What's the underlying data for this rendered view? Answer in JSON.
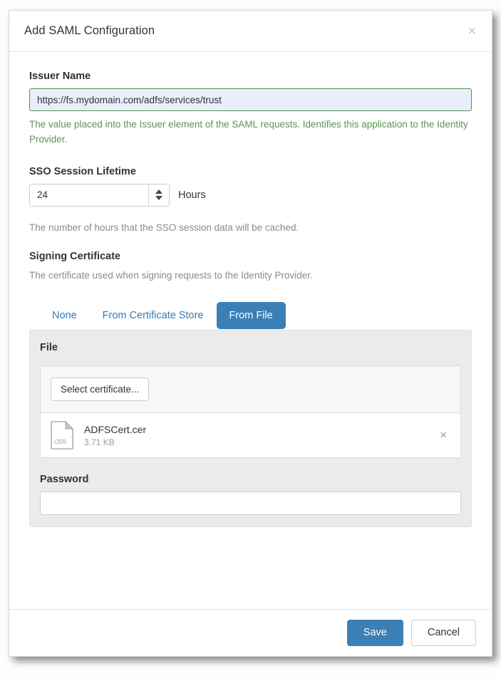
{
  "dialog": {
    "title": "Add SAML Configuration",
    "close_icon": "close-icon",
    "close_glyph": "×"
  },
  "issuer": {
    "label": "Issuer Name",
    "value": "https://fs.mydomain.com/adfs/services/trust",
    "placeholder": "",
    "help": "The value placed into the Issuer element of the SAML requests. Identifies this application to the Identity Provider.",
    "help_color": "#5b9455",
    "border_color": "#57924f",
    "background_color": "#e9eefb"
  },
  "sso_session": {
    "label": "SSO Session Lifetime",
    "value": "24",
    "placeholder": "",
    "unit": "Hours",
    "help": "The number of hours that the SSO session data will be cached.",
    "increment_icon": "arrow-up-icon",
    "decrement_icon": "arrow-down-icon"
  },
  "signing_certificate": {
    "label": "Signing Certificate",
    "help": "The certificate used when signing requests to the Identity Provider.",
    "tabs": [
      {
        "label": "None",
        "active": false
      },
      {
        "label": "From Certificate Store",
        "active": false
      },
      {
        "label": "From File",
        "active": true
      }
    ],
    "active_tab_color": "#3a7fb5",
    "tab_link_color": "#337ab7"
  },
  "file_panel": {
    "label": "File",
    "select_button": "Select certificate...",
    "file": {
      "icon": "certificate-file-icon",
      "icon_label": "CER",
      "name": "ADFSCert.cer",
      "size": "3.71 KB",
      "remove_icon": "close-icon",
      "remove_glyph": "×"
    },
    "password": {
      "label": "Password",
      "value": "",
      "placeholder": ""
    }
  },
  "footer": {
    "save_label": "Save",
    "cancel_label": "Cancel",
    "save_color": "#3a7fb5"
  }
}
